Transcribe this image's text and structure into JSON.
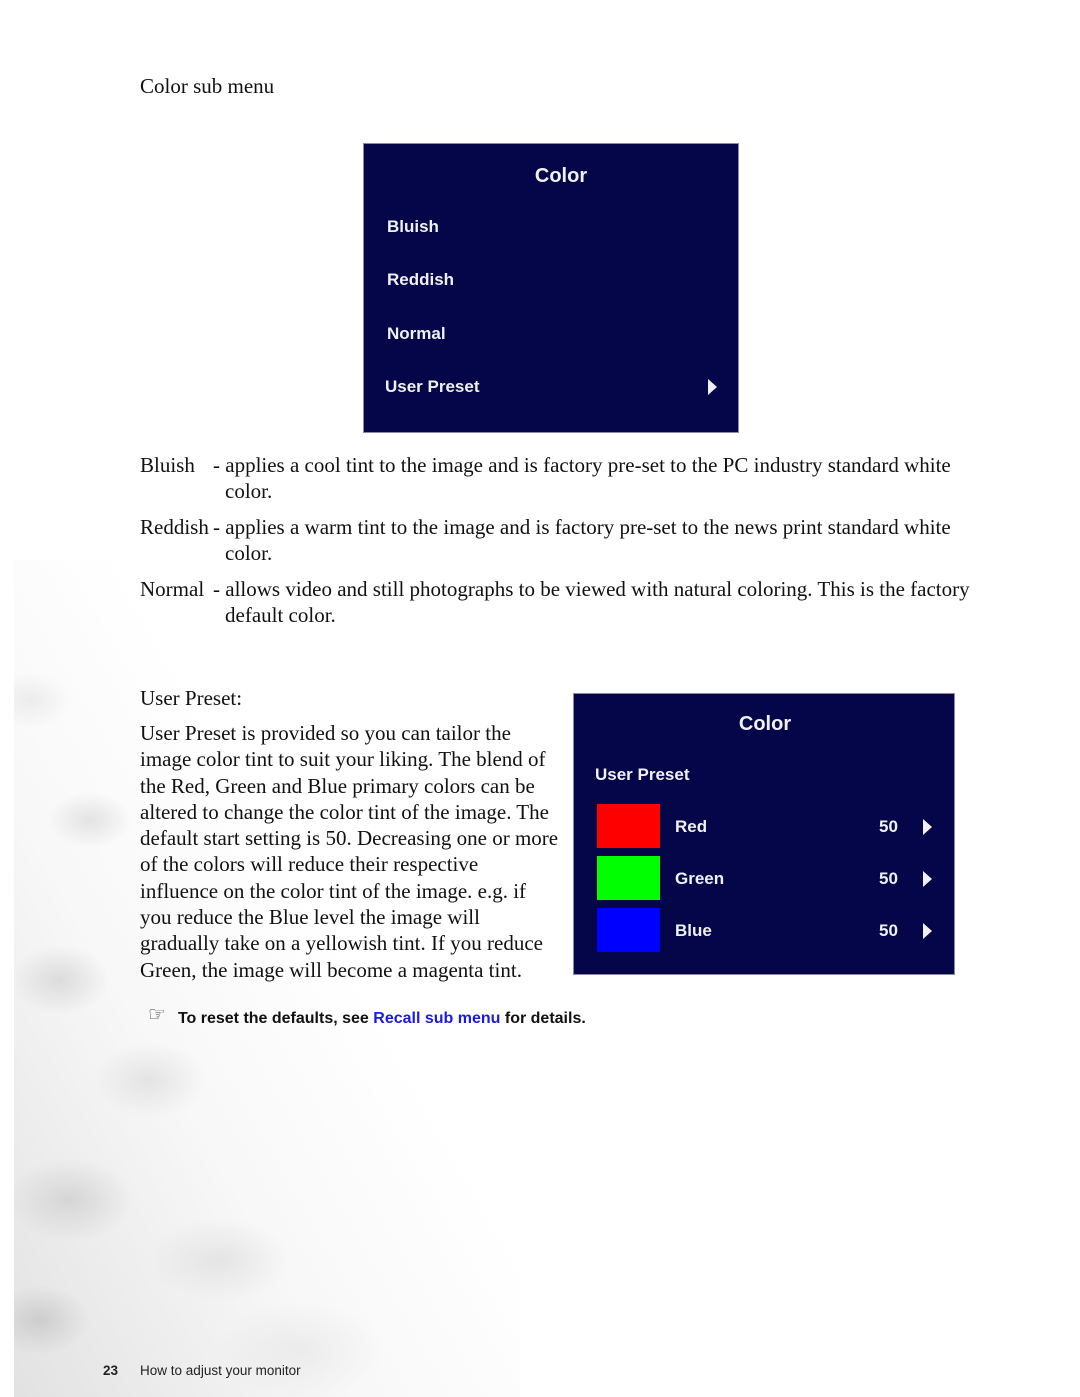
{
  "section_title": "Color sub menu",
  "osd_main": {
    "title": "Color",
    "items": [
      {
        "label": "Bluish",
        "has_submenu": false
      },
      {
        "label": "Reddish",
        "has_submenu": false
      },
      {
        "label": "Normal",
        "has_submenu": false
      },
      {
        "label": "User Preset",
        "has_submenu": true
      }
    ],
    "arrow_icon": "triangle-right"
  },
  "definitions": [
    {
      "term": "Bluish",
      "desc": "- applies a cool tint to the image and is factory pre-set to the PC industry standard white color."
    },
    {
      "term": "Reddish",
      "desc": "- applies a warm tint to the image and is factory pre-set to the news print standard white color."
    },
    {
      "term": "Normal",
      "desc": "- allows video and still photographs to be viewed with natural coloring. This is the factory default color."
    }
  ],
  "user_preset": {
    "heading": "User Preset:",
    "body": "User Preset is provided so you can tailor the image color tint to suit your liking. The blend of the Red, Green and Blue primary colors can be altered to change the color tint of the image. The default start setting is 50. Decreasing one or more of the colors will reduce their respective influence on the color tint of the image. e.g. if you reduce the Blue level the image will gradually take on a yellowish tint. If you reduce Green, the image will become a magenta tint."
  },
  "osd_user_preset": {
    "title": "Color",
    "subtitle": "User Preset",
    "channels": [
      {
        "label": "Red",
        "value": "50",
        "swatch_color": "#ff0000"
      },
      {
        "label": "Green",
        "value": "50",
        "swatch_color": "#00ff00"
      },
      {
        "label": "Blue",
        "value": "50",
        "swatch_color": "#0000ff"
      }
    ]
  },
  "note": {
    "icon": "pointing-hand",
    "text_before": "To reset the defaults, see ",
    "link_text": "Recall sub menu",
    "text_after": " for details.",
    "link_color": "#1a1ae0"
  },
  "footer": {
    "page_number": "23",
    "chapter": "How to adjust your monitor"
  },
  "colors": {
    "osd_background": "#05054a",
    "osd_text": "#f0f0f0"
  }
}
